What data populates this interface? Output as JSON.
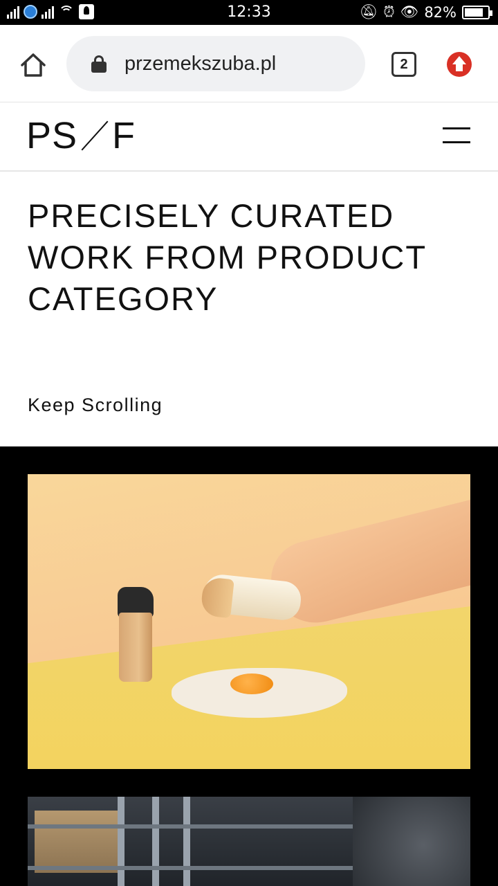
{
  "status_bar": {
    "time": "12:33",
    "battery_percent": "82%",
    "battery_level": 0.82,
    "icons": [
      "signal-icon",
      "globe-icon",
      "signal-icon",
      "wifi-icon",
      "download-icon",
      "mute-icon",
      "alarm-icon",
      "eye-icon",
      "battery-icon"
    ]
  },
  "browser": {
    "url": "przemekszuba.pl",
    "tab_count": "2",
    "icons": [
      "home-icon",
      "lock-icon",
      "tabs-icon",
      "update-icon"
    ]
  },
  "site": {
    "logo_left": "PS",
    "logo_right": "F",
    "menu_icon": "hamburger-icon"
  },
  "hero": {
    "title": "PRECISELY CURATED WORK FROM PRODUCT CATEGORY",
    "scroll_cue": "Keep Scrolling"
  },
  "colors": {
    "accent_red": "#d93025",
    "gallery_bg": "#000000",
    "photo1_bg": "#f8c993"
  }
}
